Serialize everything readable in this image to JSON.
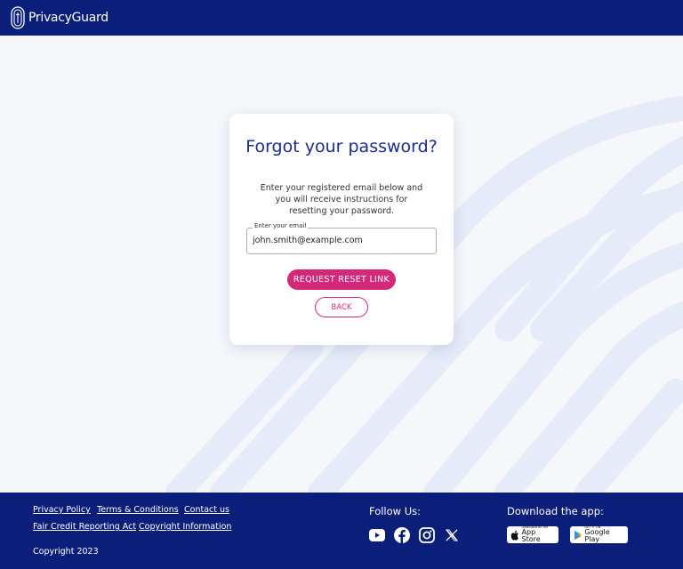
{
  "header": {
    "brand": "PrivacyGuard"
  },
  "card": {
    "title": "Forgot your password?",
    "description": "Enter your registered email below and you will receive instructions for resetting your password.",
    "email_label": "Enter your email",
    "email_value": "john.smith@example.com",
    "submit_label": "REQUEST RESET LINK",
    "back_label": "BACK"
  },
  "footer": {
    "links": {
      "privacy": "Privacy Policy",
      "terms": "Terms & Conditions",
      "contact": "Contact us",
      "fcra": "Fair Credit Reporting Act",
      "copyright_info": "Copyright Information"
    },
    "copyright": "Copyright 2023",
    "follow_title": "Follow Us:",
    "social_icons": [
      "youtube-icon",
      "facebook-icon",
      "instagram-icon",
      "x-icon"
    ],
    "download_title": "Download the app:",
    "app_store": {
      "small": "Download on the",
      "big": "App Store"
    },
    "google_play": {
      "small": "GET IT ON",
      "big": "Google Play"
    }
  },
  "colors": {
    "header_bg": "#0b1f7a",
    "footer_bg": "#0b1f7a",
    "accent": "#d6287a",
    "title": "#1a2d8f",
    "page_bg": "#f5f7fb"
  }
}
